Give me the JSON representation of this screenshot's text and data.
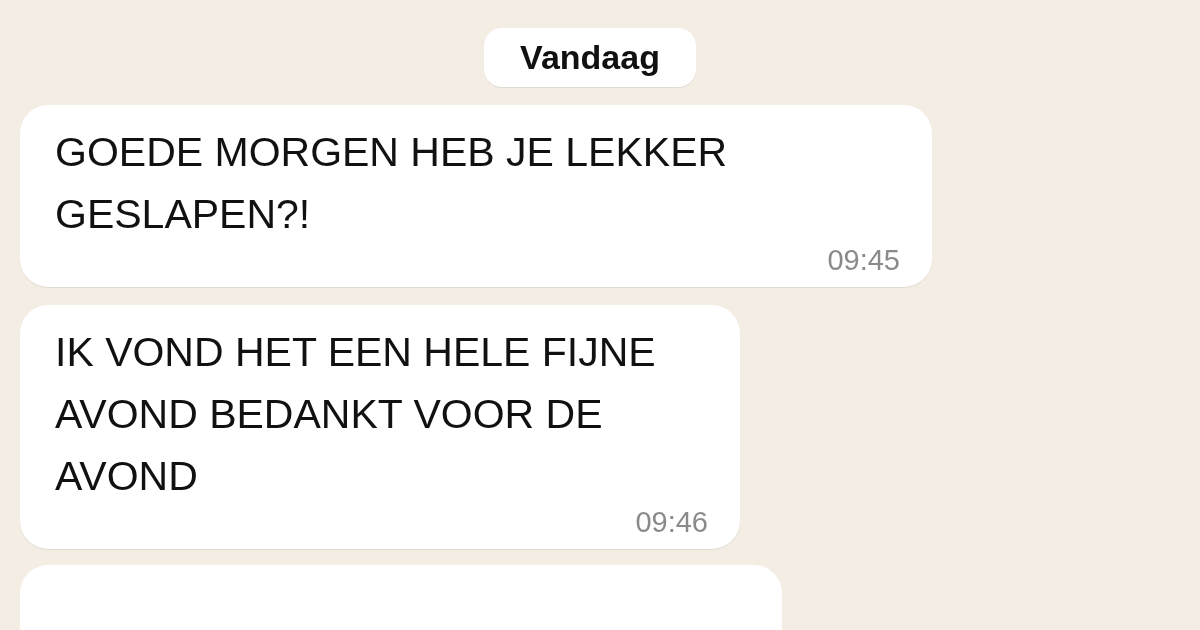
{
  "date_separator": "Vandaag",
  "messages": [
    {
      "text": "GOEDE MORGEN HEB JE LEKKER GESLAPEN?!",
      "time": "09:45"
    },
    {
      "text": "IK VOND HET EEN HELE FIJNE AVOND BEDANKT VOOR DE AVOND",
      "time": "09:46"
    }
  ]
}
